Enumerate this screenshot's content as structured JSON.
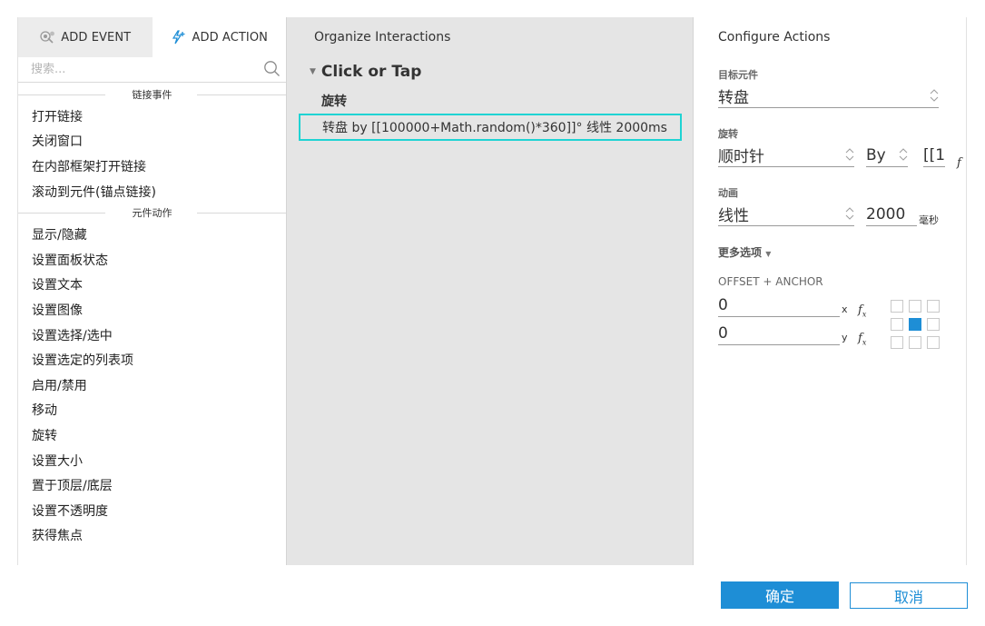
{
  "left": {
    "tabs": [
      {
        "label": "ADD EVENT",
        "icon": "add-event-icon"
      },
      {
        "label": "ADD ACTION",
        "icon": "add-action-icon"
      }
    ],
    "search_placeholder": "搜索...",
    "sections": [
      {
        "title": "链接事件",
        "items": [
          "打开链接",
          "关闭窗口",
          "在内部框架打开链接",
          "滚动到元件(锚点链接)"
        ]
      },
      {
        "title": "元件动作",
        "items": [
          "显示/隐藏",
          "设置面板状态",
          "设置文本",
          "设置图像",
          "设置选择/选中",
          "设置选定的列表项",
          "启用/禁用",
          "移动",
          "旋转",
          "设置大小",
          "置于顶层/底层",
          "设置不透明度",
          "获得焦点"
        ]
      }
    ]
  },
  "middle": {
    "title": "Organize Interactions",
    "event": "Click or Tap",
    "case": "旋转",
    "action": "转盘 by [[100000+Math.random()*360]]° 线性 2000ms"
  },
  "right": {
    "title": "Configure Actions",
    "target_label": "目标元件",
    "target_value": "转盘",
    "rotate_label": "旋转",
    "direction_value": "顺时针",
    "by_value": "By",
    "expr_value": "[[1",
    "anim_label": "动画",
    "easing_value": "线性",
    "duration_value": "2000",
    "duration_unit": "毫秒",
    "more_label": "更多选项",
    "offset_label": "OFFSET + ANCHOR",
    "offset_x": "0",
    "offset_x_unit": "x",
    "offset_y": "0",
    "offset_y_unit": "y",
    "fx_symbol": "f",
    "fx_sub": "x",
    "anchor_selected_index": 4
  },
  "footer": {
    "ok_label": "确定",
    "cancel_label": "取消"
  },
  "colors": {
    "accent": "#1e8ed6",
    "highlight": "#1fd3d3",
    "middle_bg": "#e5e5e5"
  }
}
